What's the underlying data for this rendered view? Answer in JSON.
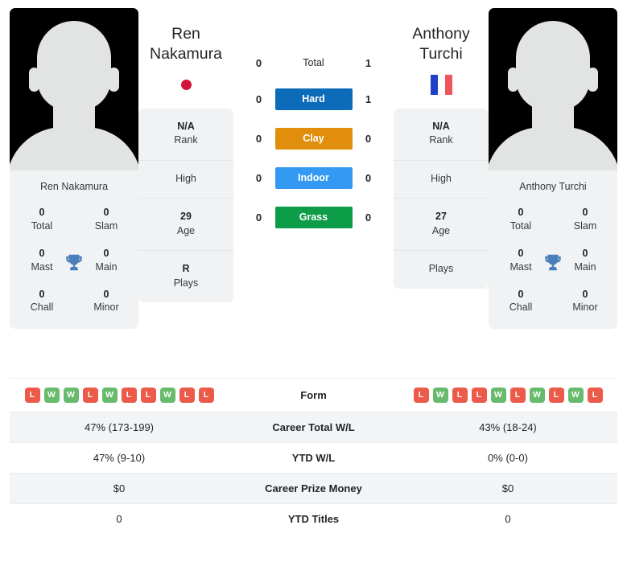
{
  "colors": {
    "hard": "#0d6cb9",
    "clay": "#e08e0b",
    "indoor": "#3399f3",
    "grass": "#0d9c47",
    "win": "#68bb6c",
    "loss": "#ec5b4a",
    "trophy": "#4a7ebb",
    "card_bg": "#f1f2f3",
    "stripe_bg": "#f3f4f5"
  },
  "players": {
    "left": {
      "first_name": "Ren",
      "last_name": "Nakamura",
      "full_name": "Ren Nakamura",
      "flag": "flag-japan-icon",
      "photo": "player-photo-placeholder",
      "titles": [
        {
          "value": "0",
          "label": "Total"
        },
        {
          "value": "0",
          "label": "Slam"
        },
        {
          "value": "0",
          "label": "Mast"
        },
        {
          "value": "0",
          "label": "Main"
        },
        {
          "value": "0",
          "label": "Chall"
        },
        {
          "value": "0",
          "label": "Minor"
        }
      ],
      "info": [
        {
          "value": "N/A",
          "label": "Rank"
        },
        {
          "value": "",
          "label": "High"
        },
        {
          "value": "29",
          "label": "Age"
        },
        {
          "value": "R",
          "label": "Plays"
        }
      ],
      "form": [
        "L",
        "W",
        "W",
        "L",
        "W",
        "L",
        "L",
        "W",
        "L",
        "L"
      ],
      "career_total_wl": "47% (173-199)",
      "ytd_wl": "47% (9-10)",
      "career_prize_money": "$0",
      "ytd_titles": "0"
    },
    "right": {
      "first_name": "Anthony",
      "last_name": "Turchi",
      "full_name": "Anthony Turchi",
      "flag": "flag-france-icon",
      "photo": "player-photo-placeholder",
      "titles": [
        {
          "value": "0",
          "label": "Total"
        },
        {
          "value": "0",
          "label": "Slam"
        },
        {
          "value": "0",
          "label": "Mast"
        },
        {
          "value": "0",
          "label": "Main"
        },
        {
          "value": "0",
          "label": "Chall"
        },
        {
          "value": "0",
          "label": "Minor"
        }
      ],
      "info": [
        {
          "value": "N/A",
          "label": "Rank"
        },
        {
          "value": "",
          "label": "High"
        },
        {
          "value": "27",
          "label": "Age"
        },
        {
          "value": "",
          "label": "Plays"
        }
      ],
      "form": [
        "L",
        "W",
        "L",
        "L",
        "W",
        "L",
        "W",
        "L",
        "W",
        "L"
      ],
      "career_total_wl": "43% (18-24)",
      "ytd_wl": "0% (0-0)",
      "career_prize_money": "$0",
      "ytd_titles": "0"
    }
  },
  "head_to_head": [
    {
      "surface": "Total",
      "left": "0",
      "right": "1",
      "style": "plain",
      "color": ""
    },
    {
      "surface": "Hard",
      "left": "0",
      "right": "1",
      "style": "badge",
      "color": "#0d6cb9"
    },
    {
      "surface": "Clay",
      "left": "0",
      "right": "0",
      "style": "badge",
      "color": "#e08e0b"
    },
    {
      "surface": "Indoor",
      "left": "0",
      "right": "0",
      "style": "badge",
      "color": "#3399f3"
    },
    {
      "surface": "Grass",
      "left": "0",
      "right": "0",
      "style": "badge",
      "color": "#0d9c47"
    }
  ],
  "stats_rows": [
    {
      "label": "Form",
      "key": "form",
      "type": "form"
    },
    {
      "label": "Career Total W/L",
      "key": "career_total_wl",
      "type": "text"
    },
    {
      "label": "YTD W/L",
      "key": "ytd_wl",
      "type": "text"
    },
    {
      "label": "Career Prize Money",
      "key": "career_prize_money",
      "type": "text"
    },
    {
      "label": "YTD Titles",
      "key": "ytd_titles",
      "type": "text"
    }
  ]
}
